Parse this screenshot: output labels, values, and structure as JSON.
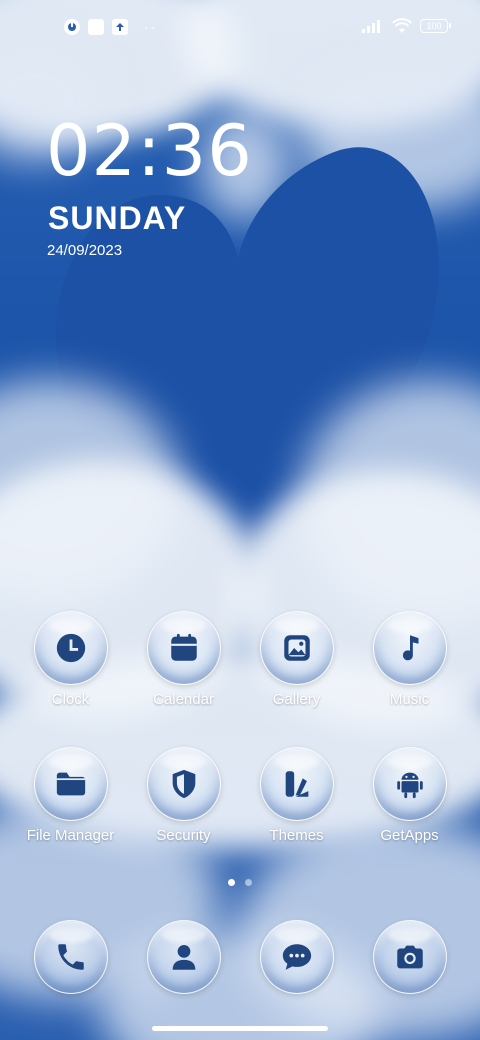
{
  "status_bar": {
    "battery": "100",
    "left_icons": [
      "app-notification-icon",
      "square-icon",
      "upload-icon"
    ],
    "overflow": "··",
    "right_icons": [
      "signal-icon",
      "wifi-icon",
      "battery-icon"
    ]
  },
  "widget": {
    "time": "02:36",
    "day": "SUNDAY",
    "date": "24/09/2023"
  },
  "apps": [
    {
      "label": "Clock",
      "icon": "clock-icon"
    },
    {
      "label": "Calendar",
      "icon": "calendar-icon"
    },
    {
      "label": "Gallery",
      "icon": "gallery-icon"
    },
    {
      "label": "Music",
      "icon": "music-icon"
    },
    {
      "label": "File Manager",
      "icon": "folder-icon"
    },
    {
      "label": "Security",
      "icon": "shield-icon"
    },
    {
      "label": "Themes",
      "icon": "themes-icon"
    },
    {
      "label": "GetApps",
      "icon": "android-icon"
    }
  ],
  "dock": [
    {
      "icon": "phone-icon"
    },
    {
      "icon": "contacts-icon"
    },
    {
      "icon": "messages-icon"
    },
    {
      "icon": "camera-icon"
    }
  ],
  "pager": {
    "current": 1,
    "total": 2
  },
  "colors": {
    "sky": "#1d55aa",
    "icon_glyph": "#21467f",
    "cloud": "#eef2f8"
  }
}
